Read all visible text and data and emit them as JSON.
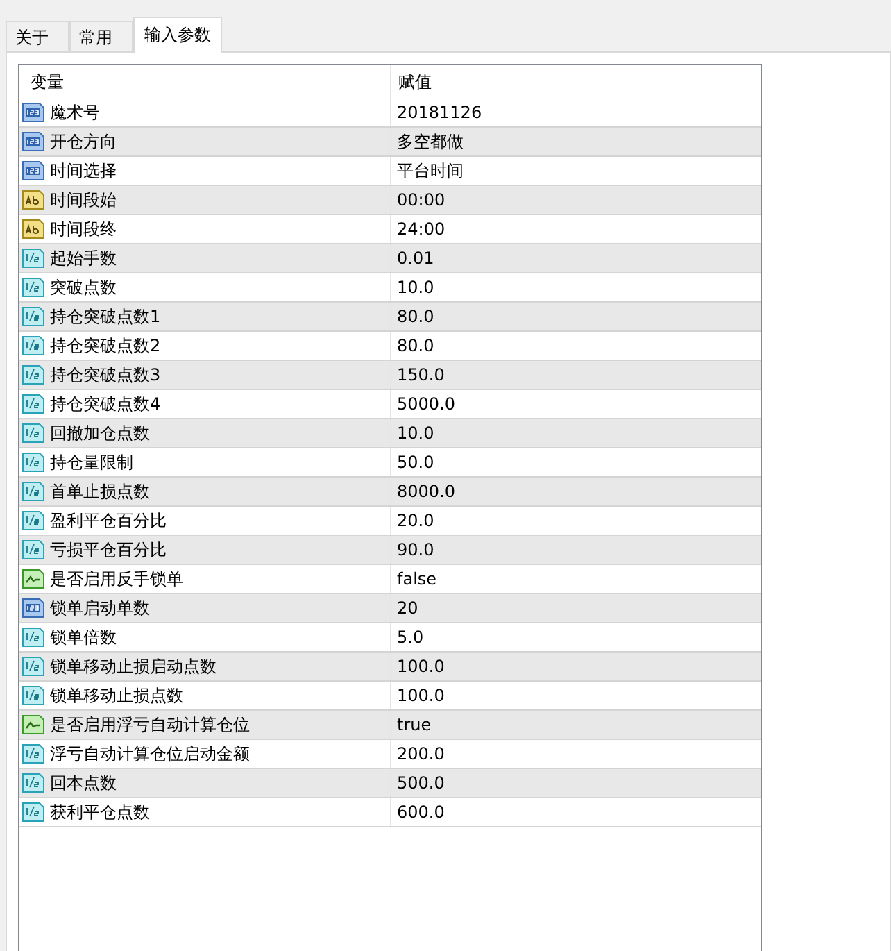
{
  "tabs": [
    {
      "label": "关于",
      "selected": false
    },
    {
      "label": "常用",
      "selected": false
    },
    {
      "label": "输入参数",
      "selected": true
    }
  ],
  "table": {
    "columns": [
      "变量",
      "赋值"
    ],
    "rows": [
      {
        "kind": "int",
        "name": "魔术号",
        "value": "20181126"
      },
      {
        "kind": "int",
        "name": "开仓方向",
        "value": "多空都做"
      },
      {
        "kind": "int",
        "name": "时间选择",
        "value": "平台时间"
      },
      {
        "kind": "string",
        "name": "时间段始",
        "value": "00:00"
      },
      {
        "kind": "string",
        "name": "时间段终",
        "value": "24:00"
      },
      {
        "kind": "double",
        "name": "起始手数",
        "value": "0.01"
      },
      {
        "kind": "double",
        "name": "突破点数",
        "value": "10.0"
      },
      {
        "kind": "double",
        "name": "持仓突破点数1",
        "value": "80.0"
      },
      {
        "kind": "double",
        "name": "持仓突破点数2",
        "value": "80.0"
      },
      {
        "kind": "double",
        "name": "持仓突破点数3",
        "value": "150.0"
      },
      {
        "kind": "double",
        "name": "持仓突破点数4",
        "value": "5000.0"
      },
      {
        "kind": "double",
        "name": "回撤加仓点数",
        "value": "10.0"
      },
      {
        "kind": "double",
        "name": "持仓量限制",
        "value": "50.0"
      },
      {
        "kind": "double",
        "name": "首单止损点数",
        "value": "8000.0"
      },
      {
        "kind": "double",
        "name": "盈利平仓百分比",
        "value": "20.0"
      },
      {
        "kind": "double",
        "name": "亏损平仓百分比",
        "value": "90.0"
      },
      {
        "kind": "bool",
        "name": "是否启用反手锁单",
        "value": "false"
      },
      {
        "kind": "int",
        "name": "锁单启动单数",
        "value": "20"
      },
      {
        "kind": "double",
        "name": "锁单倍数",
        "value": "5.0"
      },
      {
        "kind": "double",
        "name": "锁单移动止损启动点数",
        "value": "100.0"
      },
      {
        "kind": "double",
        "name": "锁单移动止损点数",
        "value": "100.0"
      },
      {
        "kind": "bool",
        "name": "是否启用浮亏自动计算仓位",
        "value": "true"
      },
      {
        "kind": "double",
        "name": "浮亏自动计算仓位启动金额",
        "value": "200.0"
      },
      {
        "kind": "double",
        "name": "回本点数",
        "value": "500.0"
      },
      {
        "kind": "double",
        "name": "获利平仓点数",
        "value": "600.0"
      }
    ]
  }
}
